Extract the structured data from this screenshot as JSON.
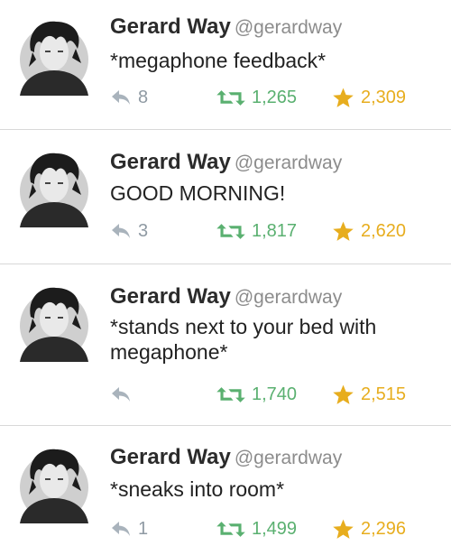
{
  "colors": {
    "retweet": "#5ab070",
    "favorite": "#e7ad1e",
    "reply": "#a9b3bc",
    "divider": "#d8d8d8"
  },
  "icons": {
    "reply": "reply-arrow-icon",
    "retweet": "retweet-icon",
    "favorite": "star-icon",
    "avatar": "profile-avatar"
  },
  "tweets": [
    {
      "name": "Gerard Way",
      "handle": "@gerardway",
      "text": "*megaphone feedback*",
      "replies": "8",
      "retweets": "1,265",
      "favorites": "2,309"
    },
    {
      "name": "Gerard Way",
      "handle": "@gerardway",
      "text": "GOOD MORNING!",
      "replies": "3",
      "retweets": "1,817",
      "favorites": "2,620"
    },
    {
      "name": "Gerard Way",
      "handle": "@gerardway",
      "text": "*stands next to your bed with megaphone*",
      "replies": "",
      "retweets": "1,740",
      "favorites": "2,515"
    },
    {
      "name": "Gerard Way",
      "handle": "@gerardway",
      "text": "*sneaks into room*",
      "replies": "1",
      "retweets": "1,499",
      "favorites": "2,296"
    }
  ]
}
